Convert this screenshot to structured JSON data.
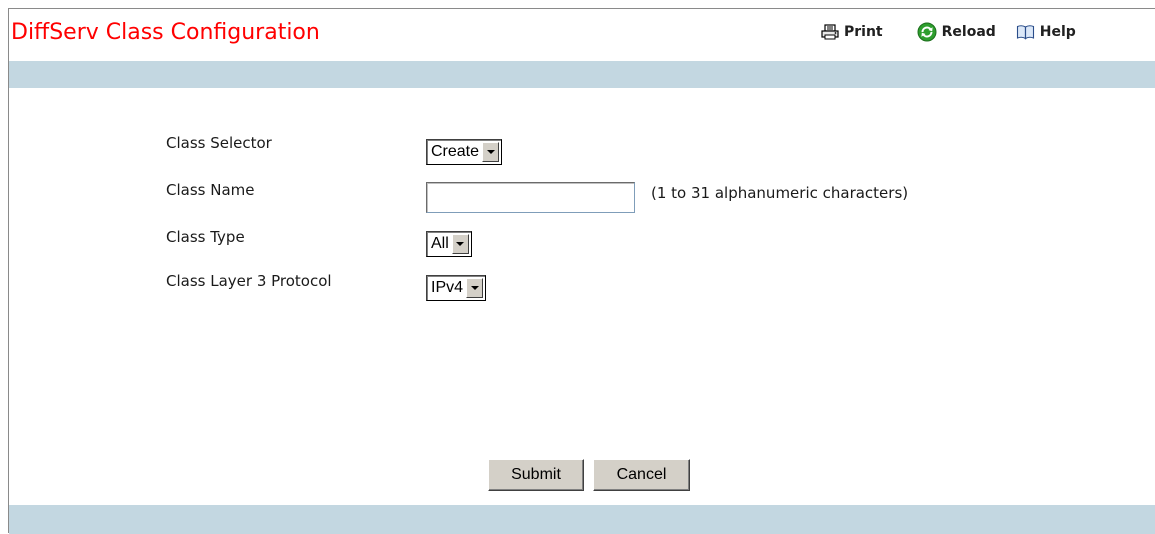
{
  "header": {
    "title": "DiffServ Class Configuration",
    "toolbar": [
      {
        "label": "Print",
        "icon": "printer-icon"
      },
      {
        "label": "Reload",
        "icon": "reload-icon"
      },
      {
        "label": "Help",
        "icon": "book-icon"
      }
    ]
  },
  "form": {
    "class_selector": {
      "label": "Class Selector",
      "value": "Create"
    },
    "class_name": {
      "label": "Class Name",
      "value": "",
      "hint": "(1 to 31 alphanumeric characters)"
    },
    "class_type": {
      "label": "Class Type",
      "value": "All"
    },
    "class_layer3_protocol": {
      "label": "Class Layer 3 Protocol",
      "value": "IPv4"
    }
  },
  "buttons": {
    "submit": "Submit",
    "cancel": "Cancel"
  },
  "colors": {
    "title": "#ff0000",
    "band": "#c3d7e1",
    "button_face": "#d4d0c8",
    "reload_icon": "#2e9e2e"
  }
}
